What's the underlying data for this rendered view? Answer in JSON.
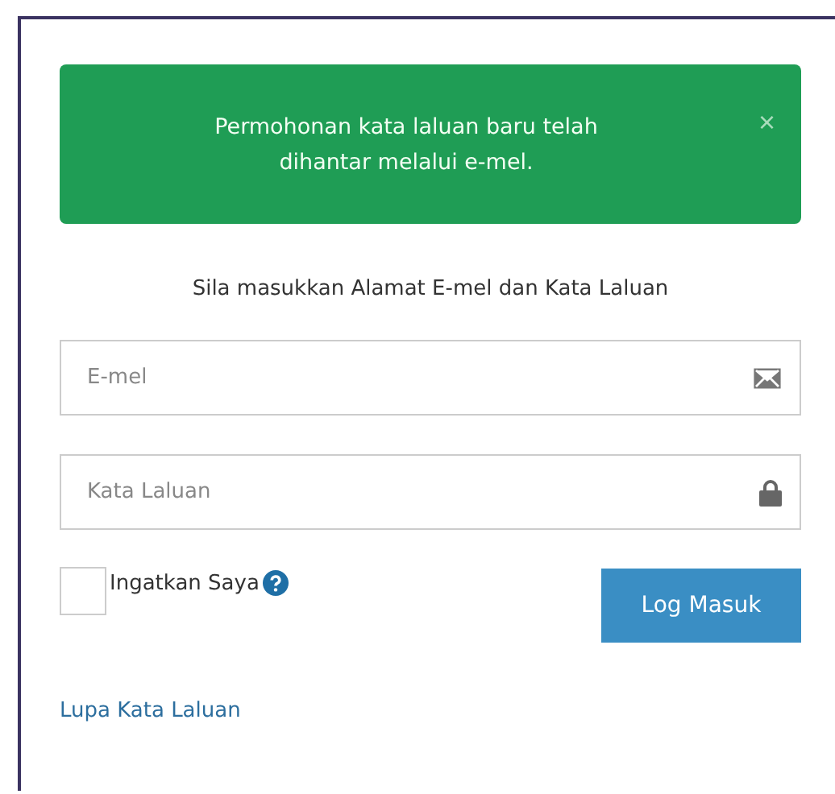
{
  "alert": {
    "message": "Permohonan kata laluan baru telah dihantar melalui e-mel.",
    "close": "×"
  },
  "instruction": "Sila masukkan Alamat E-mel dan Kata Laluan",
  "fields": [
    {
      "kind": "email",
      "placeholder": "E-mel"
    },
    {
      "kind": "password",
      "placeholder": "Kata Laluan"
    }
  ],
  "remember": {
    "label": "Ingatkan Saya",
    "checked": false
  },
  "login_button": "Log Masuk",
  "forgot_link": "Lupa Kata Laluan"
}
